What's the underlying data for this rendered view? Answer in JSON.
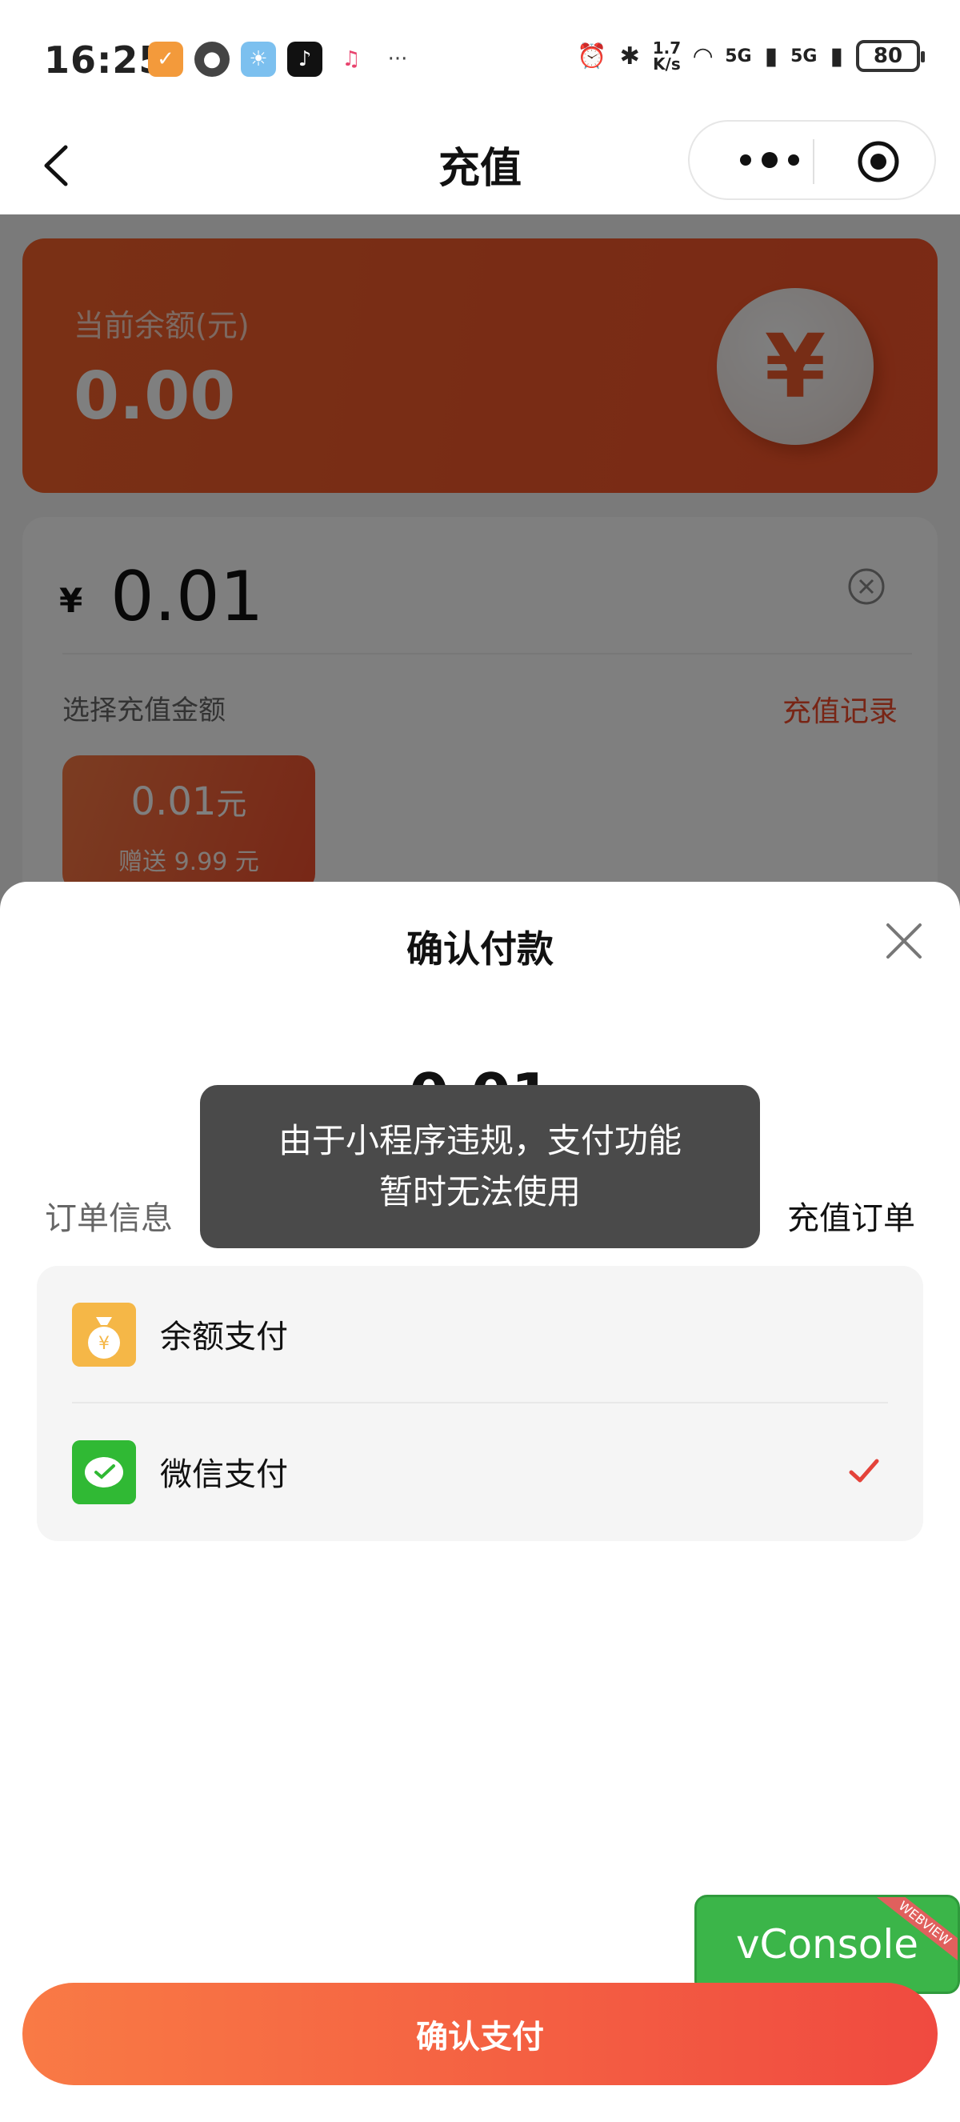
{
  "status_bar": {
    "time": "16:25",
    "net_speed_top": "1.7",
    "net_speed_bottom": "K/s",
    "signal1": "5G",
    "signal2": "5G",
    "battery": "80",
    "more": "···"
  },
  "nav": {
    "title": "充值"
  },
  "balance_card": {
    "label": "当前余额(元)",
    "value": "0.00",
    "coin_symbol": "¥"
  },
  "amount_card": {
    "currency": "¥",
    "amount": "0.01",
    "select_label": "选择充值金额",
    "record_link": "充值记录",
    "option": {
      "amount": "0.01",
      "unit": "元",
      "bonus": "赠送 9.99 元"
    }
  },
  "sheet": {
    "title": "确认付款",
    "pay_amount": "0.01",
    "order_label": "订单信息",
    "order_value": "充值订单",
    "methods": [
      {
        "label": "余额支付",
        "icon": "money-bag-icon",
        "selected": false
      },
      {
        "label": "微信支付",
        "icon": "wechat-pay-icon",
        "selected": true
      }
    ]
  },
  "toast": {
    "line1": "由于小程序违规，支付功能",
    "line2": "暂时无法使用"
  },
  "vconsole": {
    "label": "vConsole",
    "ribbon": "WEBVIEW"
  },
  "confirm_button": {
    "label": "确认支付"
  },
  "colors": {
    "accent": "#f04a2a",
    "wechat_green": "#30b934",
    "balance_orange": "#f5b747"
  }
}
